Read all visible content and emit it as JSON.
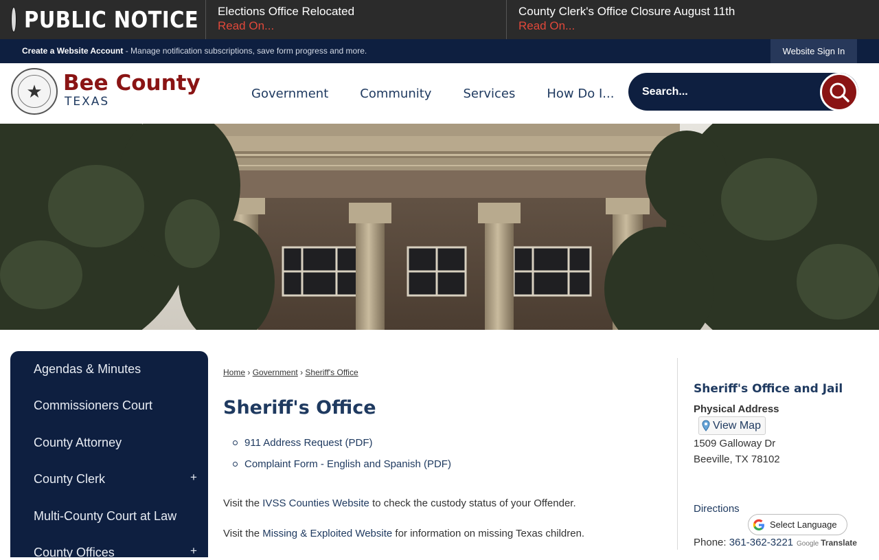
{
  "notice": {
    "title": "PUBLIC NOTICE",
    "items": [
      {
        "title": "Elections Office Relocated",
        "link": "Read On..."
      },
      {
        "title": "County Clerk's Office Closure August 11th",
        "link": "Read On..."
      }
    ]
  },
  "account_bar": {
    "create_label": "Create a Website Account",
    "create_desc": " - Manage notification subscriptions, save form progress and more.",
    "signin_label": "Website Sign In"
  },
  "header": {
    "logo_name": "Bee County",
    "logo_sub": "TEXAS",
    "nav": [
      "Government",
      "Community",
      "Services",
      "How Do I..."
    ],
    "search_placeholder": "Search..."
  },
  "sidebar": {
    "items": [
      {
        "label": "Agendas & Minutes",
        "expandable": false
      },
      {
        "label": "Commissioners Court",
        "expandable": false
      },
      {
        "label": "County Attorney",
        "expandable": false
      },
      {
        "label": "County Clerk",
        "expandable": true,
        "toggle": "+"
      },
      {
        "label": "Multi-County Court at Law",
        "expandable": false
      },
      {
        "label": "County Offices",
        "expandable": true,
        "toggle": "+"
      }
    ]
  },
  "main": {
    "breadcrumb": [
      "Home",
      "Government",
      "Sheriff's Office"
    ],
    "breadcrumb_sep": "›",
    "title": "Sheriff's Office",
    "documents": [
      "911 Address Request (PDF)",
      "Complaint Form - English and Spanish (PDF)"
    ],
    "para1": {
      "pre": "Visit the ",
      "link": "IVSS Counties Website",
      "post": " to check the custody status of your Offender."
    },
    "para2": {
      "pre": "Visit the ",
      "link": "Missing & Exploited Website",
      "post": " for information on missing Texas children."
    }
  },
  "contact": {
    "title": "Sheriff's Office and Jail",
    "address_label": "Physical Address",
    "view_map": "View Map",
    "address_line1": "1509 Galloway Dr",
    "address_line2": "Beeville, TX 78102",
    "directions": "Directions",
    "phone_label": "Phone: ",
    "phone": "361-362-3221"
  },
  "translate": {
    "label": "Select Language",
    "powered_prefix": "Google",
    "powered_word": "Translate"
  },
  "colors": {
    "navy": "#0e1f40",
    "maroon": "#8a1414",
    "alert_red": "#e0483a"
  }
}
